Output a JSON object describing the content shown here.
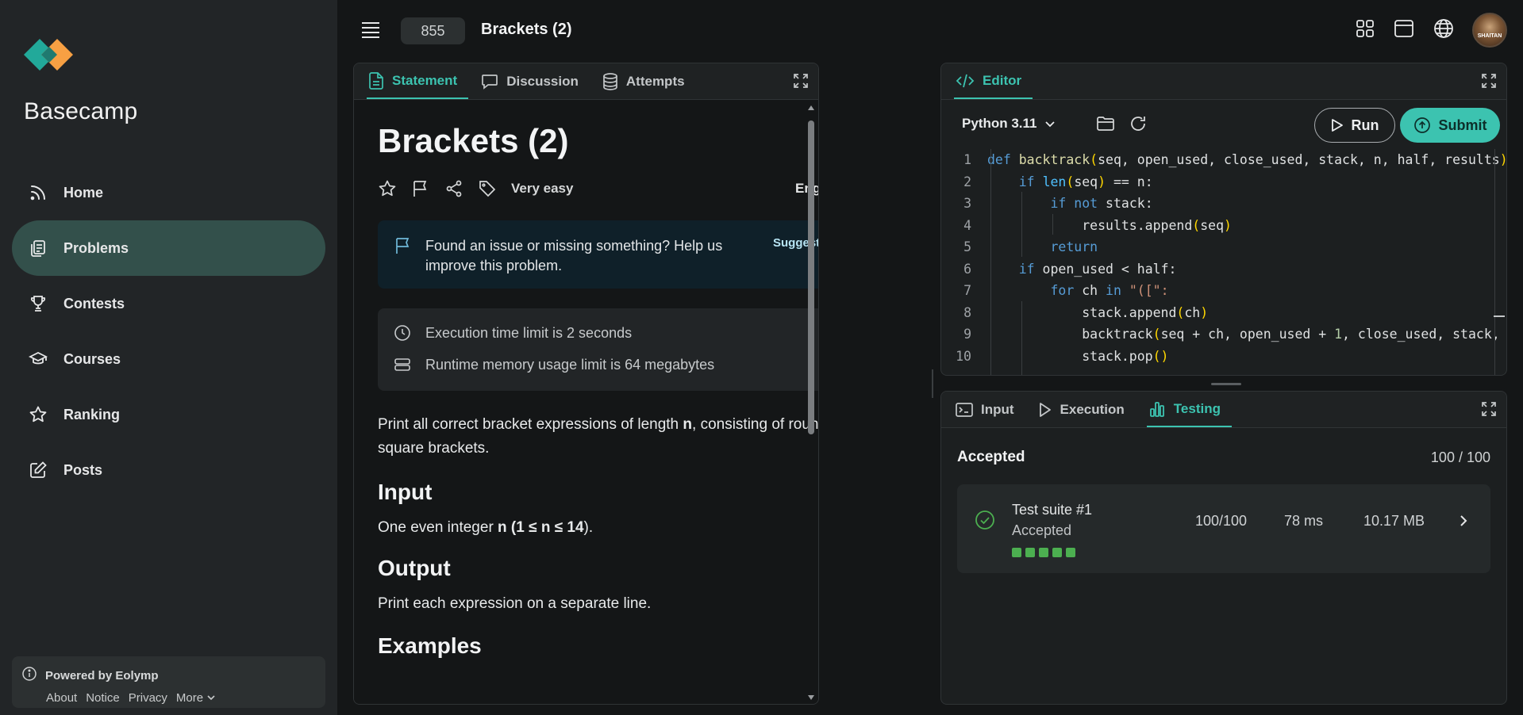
{
  "sidebar": {
    "brand": "Basecamp",
    "items": [
      {
        "label": "Home",
        "icon": "rss-icon"
      },
      {
        "label": "Problems",
        "icon": "clipboard-icon",
        "active": true
      },
      {
        "label": "Contests",
        "icon": "trophy-icon"
      },
      {
        "label": "Courses",
        "icon": "graduation-cap-icon"
      },
      {
        "label": "Ranking",
        "icon": "star-icon"
      },
      {
        "label": "Posts",
        "icon": "edit-icon"
      }
    ],
    "powered": {
      "label": "Powered by Eolymp",
      "links": [
        "About",
        "Notice",
        "Privacy",
        "More"
      ]
    }
  },
  "header": {
    "problem_id": "855",
    "title": "Brackets (2)",
    "avatar_text": "SHAITAN"
  },
  "statement": {
    "tabs": [
      "Statement",
      "Discussion",
      "Attempts"
    ],
    "title": "Brackets (2)",
    "difficulty": "Very easy",
    "language": "English",
    "issue_text": "Found an issue or missing something? Help us improve this problem.",
    "suggest_label": "Suggest change",
    "time_limit": "Execution time limit is 2 seconds",
    "memory_limit": "Runtime memory usage limit is 64 megabytes",
    "desc_a": "Print all correct bracket expressions of length ",
    "desc_b": "n",
    "desc_c": ", consisting of round and square brackets.",
    "input_heading": "Input",
    "input_a": "One even integer ",
    "input_b": "n",
    "input_c": " (",
    "input_d": "1  ≤ n ≤ 14",
    "input_e": ").",
    "output_heading": "Output",
    "output_text": "Print each expression on a separate line.",
    "examples_heading": "Examples"
  },
  "editor": {
    "tab": "Editor",
    "runtime": "Python 3.11",
    "run_label": "Run",
    "submit_label": "Submit",
    "line_numbers": [
      "1",
      "2",
      "3",
      "4",
      "5",
      "6",
      "7",
      "8",
      "9",
      "10"
    ]
  },
  "testing": {
    "tabs": [
      "Input",
      "Execution",
      "Testing"
    ],
    "result": "Accepted",
    "score": "100 / 100",
    "suite_name": "Test suite #1",
    "suite_status": "Accepted",
    "suite_score": "100/100",
    "suite_time": "78 ms",
    "suite_memory": "10.17 MB",
    "tests_passed": 5
  },
  "colors": {
    "accent": "#3cc3b0",
    "active_nav": "#33504b",
    "success": "#4caf50"
  }
}
